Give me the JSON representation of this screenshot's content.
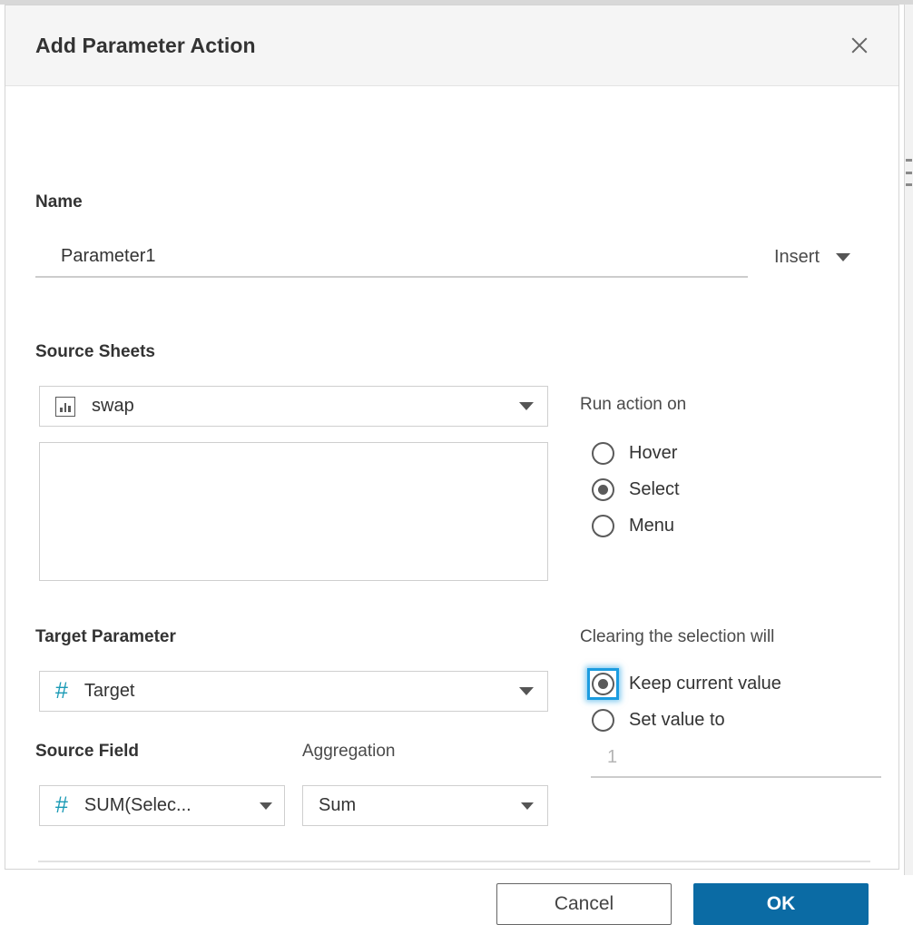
{
  "dialog": {
    "title": "Add Parameter Action",
    "close_icon": "close-icon"
  },
  "name_section": {
    "label": "Name",
    "value": "Parameter1",
    "placeholder": "",
    "insert_label": "Insert",
    "insert_caret_icon": "chevron-down-icon"
  },
  "source_sheets": {
    "label": "Source Sheets",
    "selected_sheet": "swap",
    "sheet_icon": "worksheet-bar-chart-icon",
    "caret_icon": "chevron-down-icon",
    "list_items": []
  },
  "run_action_on": {
    "label": "Run action on",
    "options": [
      {
        "label": "Hover",
        "checked": false
      },
      {
        "label": "Select",
        "checked": true
      },
      {
        "label": "Menu",
        "checked": false
      }
    ]
  },
  "target_parameter": {
    "label": "Target Parameter",
    "selected": "Target",
    "field_icon": "number-hash-icon",
    "caret_icon": "chevron-down-icon"
  },
  "source_field": {
    "label": "Source Field",
    "selected": "SUM(Selec...",
    "field_icon": "number-hash-icon",
    "caret_icon": "chevron-down-icon"
  },
  "aggregation": {
    "label": "Aggregation",
    "selected": "Sum",
    "caret_icon": "chevron-down-icon"
  },
  "clearing_selection": {
    "label": "Clearing the selection will",
    "options": [
      {
        "label": "Keep current value",
        "checked": true,
        "focused": true
      },
      {
        "label": "Set value to",
        "checked": false,
        "focused": false
      }
    ],
    "set_value_placeholder": "1"
  },
  "footer": {
    "cancel_label": "Cancel",
    "ok_label": "OK"
  },
  "colors": {
    "accent_blue": "#0b6ba4",
    "focus_blue": "#1b9ce0",
    "field_icon_teal": "#1a9ab5",
    "header_bg": "#f5f5f5"
  }
}
